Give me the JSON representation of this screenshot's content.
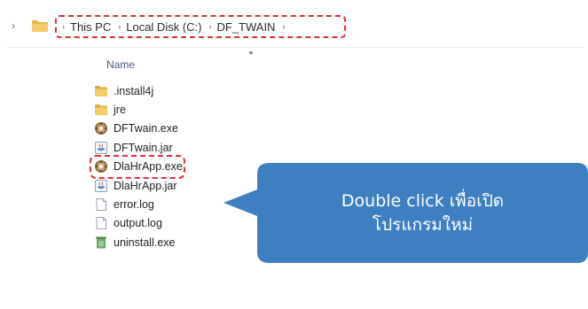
{
  "address_bar": {
    "nav_chevron": "›",
    "breadcrumb": [
      {
        "label": "This PC"
      },
      {
        "label": "Local Disk (C:)"
      },
      {
        "label": "DF_TWAIN"
      }
    ],
    "separator": "›",
    "highlight_color": "#e0303a"
  },
  "file_list": {
    "column_header": "Name",
    "items": [
      {
        "name": ".install4j",
        "icon": "folder-icon"
      },
      {
        "name": "jre",
        "icon": "folder-icon"
      },
      {
        "name": "DFTwain.exe",
        "icon": "exe-app-icon"
      },
      {
        "name": "DFTwain.jar",
        "icon": "jar-file-icon"
      },
      {
        "name": "DlaHrApp.exe",
        "icon": "exe-app-icon",
        "highlighted": true
      },
      {
        "name": "DlaHrApp.jar",
        "icon": "jar-file-icon"
      },
      {
        "name": "error.log",
        "icon": "text-file-icon"
      },
      {
        "name": "output.log",
        "icon": "text-file-icon"
      },
      {
        "name": "uninstall.exe",
        "icon": "uninstall-icon"
      }
    ]
  },
  "callout": {
    "line1": "Double click เพื่อเปิด",
    "line2": "โปรแกรมใหม่",
    "background": "#3d7fc0"
  }
}
